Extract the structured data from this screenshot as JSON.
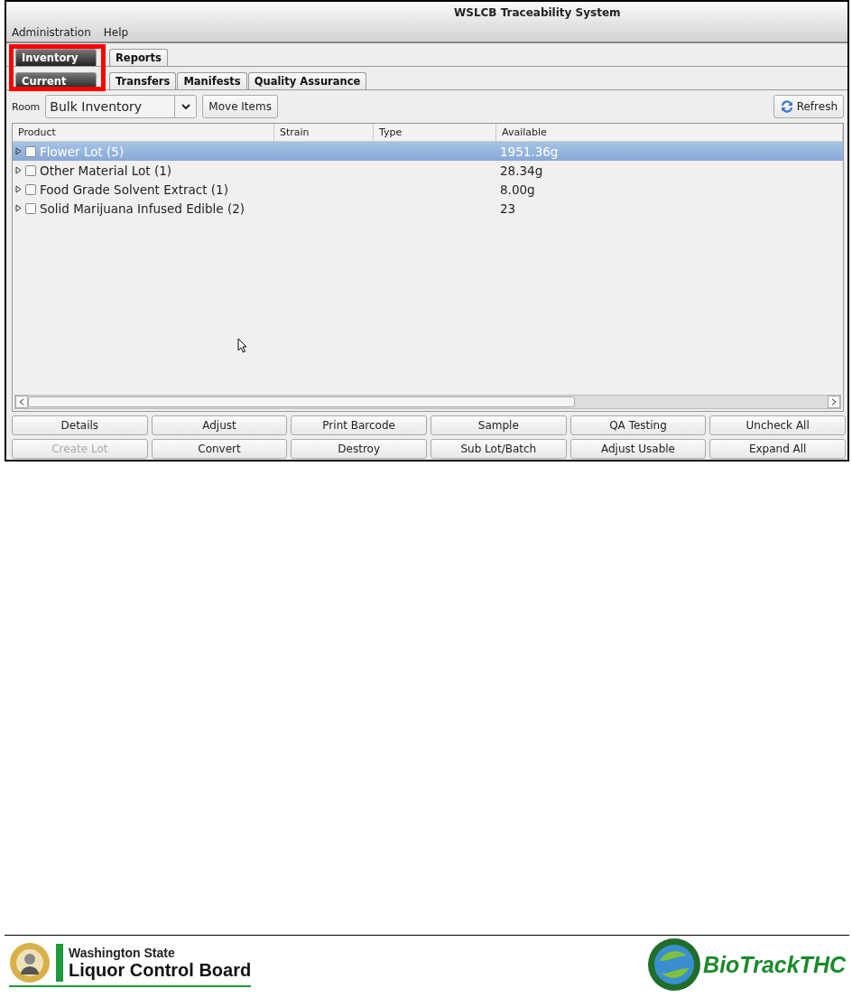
{
  "window": {
    "title": "WSLCB Traceability System"
  },
  "menu": [
    "Administration",
    "Help"
  ],
  "tabs": [
    {
      "label": "Inventory",
      "selected": true
    },
    {
      "label": "Reports",
      "selected": false
    }
  ],
  "subtabs": [
    {
      "label": "Current",
      "selected": true
    },
    {
      "label": "Transfers",
      "selected": false
    },
    {
      "label": "Manifests",
      "selected": false
    },
    {
      "label": "Quality Assurance",
      "selected": false
    }
  ],
  "toolbar": {
    "room_label": "Room",
    "room_value": "Bulk Inventory",
    "move_button": "Move Items",
    "refresh_button": "Refresh"
  },
  "table": {
    "columns": [
      "Product",
      "Strain",
      "Type",
      "Available"
    ],
    "rows": [
      {
        "product": "Flower Lot (5)",
        "available": "1951.36g",
        "selected": true,
        "checked": false,
        "expanded": false
      },
      {
        "product": "Other Material Lot (1)",
        "available": "28.34g",
        "selected": false,
        "checked": false,
        "expanded": false
      },
      {
        "product": "Food Grade Solvent Extract (1)",
        "available": "8.00g",
        "selected": false,
        "checked": false,
        "expanded": false
      },
      {
        "product": "Solid Marijuana Infused Edible (2)",
        "available": "23",
        "selected": false,
        "checked": false,
        "expanded": false
      }
    ]
  },
  "buttons": [
    {
      "label": "Details",
      "disabled": false
    },
    {
      "label": "Adjust",
      "disabled": false
    },
    {
      "label": "Print Barcode",
      "disabled": false
    },
    {
      "label": "Sample",
      "disabled": false
    },
    {
      "label": "QA Testing",
      "disabled": false
    },
    {
      "label": "Uncheck All",
      "disabled": false
    },
    {
      "label": "Create Lot",
      "disabled": true
    },
    {
      "label": "Convert",
      "disabled": false
    },
    {
      "label": "Destroy",
      "disabled": false
    },
    {
      "label": "Sub Lot/Batch",
      "disabled": false
    },
    {
      "label": "Adjust Usable",
      "disabled": false
    },
    {
      "label": "Expand All",
      "disabled": false
    }
  ],
  "footer": {
    "agency_line1": "Washington State",
    "agency_line2": "Liquor Control Board",
    "vendor": "BioTrackTHC"
  }
}
